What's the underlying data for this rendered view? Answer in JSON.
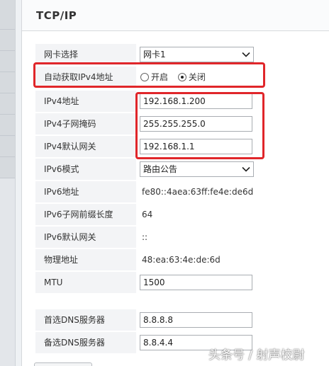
{
  "tab": {
    "title": "TCP/IP"
  },
  "form": {
    "nic": {
      "label": "网卡选择",
      "value": "网卡1"
    },
    "auto_ipv4": {
      "label": "自动获取IPv4地址",
      "options": [
        {
          "label": "开启",
          "checked": false
        },
        {
          "label": "关闭",
          "checked": true
        }
      ]
    },
    "ipv4_addr": {
      "label": "IPv4地址",
      "value": "192.168.1.200"
    },
    "ipv4_mask": {
      "label": "IPv4子网掩码",
      "value": "255.255.255.0"
    },
    "ipv4_gw": {
      "label": "IPv4默认网关",
      "value": "192.168.1.1"
    },
    "ipv6_mode": {
      "label": "IPv6模式",
      "value": "路由公告"
    },
    "ipv6_addr": {
      "label": "IPv6地址",
      "value": "fe80::4aea:63ff:fe4e:de6d"
    },
    "ipv6_prefix": {
      "label": "IPv6子网前缀长度",
      "value": "64"
    },
    "ipv6_gw": {
      "label": "IPv6默认网关",
      "value": "::"
    },
    "mac": {
      "label": "物理地址",
      "value": "48:ea:63:4e:de:6d"
    },
    "mtu": {
      "label": "MTU",
      "value": "1500"
    },
    "dns1": {
      "label": "首选DNS服务器",
      "value": "8.8.8.8"
    },
    "dns2": {
      "label": "备选DNS服务器",
      "value": "8.8.4.4"
    }
  },
  "watermark": "头条号 / 射声校尉",
  "colors": {
    "highlight": "#e0262a",
    "label_bg": "#f3f4f6"
  }
}
